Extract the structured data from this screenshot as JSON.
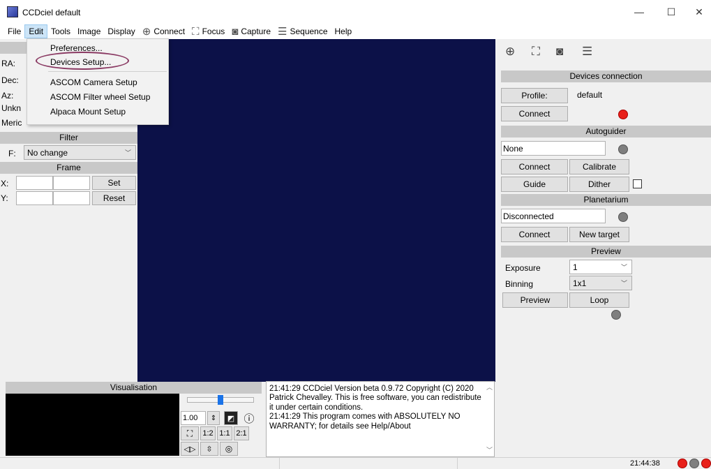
{
  "window": {
    "title": "CCDciel default",
    "minimize": "—",
    "maximize": "☐",
    "close": "✕"
  },
  "menubar": {
    "file": "File",
    "edit": "Edit",
    "tools": "Tools",
    "image": "Image",
    "display": "Display",
    "connect": "Connect",
    "focus": "Focus",
    "capture": "Capture",
    "sequence": "Sequence",
    "help": "Help"
  },
  "edit_menu": {
    "preferences": "Preferences...",
    "devices_setup": "Devices Setup...",
    "ascom_camera": "ASCOM Camera Setup",
    "ascom_filter": "ASCOM Filter wheel Setup",
    "alpaca_mount": "Alpaca Mount Setup"
  },
  "left_panel": {
    "ra_label": "RA:",
    "dec_label": "Dec:",
    "az_label": "Az:",
    "unknown_label": "Unkn",
    "meridian_label": "Meric",
    "filter_header": "Filter",
    "filter_label": "F:",
    "filter_value": "No change",
    "frame_header": "Frame",
    "x_label": "X:",
    "y_label": "Y:",
    "set_button": "Set",
    "reset_button": "Reset"
  },
  "visualisation": {
    "header": "Visualisation",
    "gamma_value": "1.00",
    "zoom_1_2": "1:2",
    "zoom_1_1": "1:1",
    "zoom_2_1": "2:1"
  },
  "log": {
    "lines": [
      "21:41:29 CCDciel Version beta 0.9.72 Copyright (C) 2020",
      "Patrick Chevalley. This is free software, you can redistribute",
      "it under certain conditions.",
      "21:41:29 This program comes with ABSOLUTELY NO",
      "WARRANTY; for details see Help/About"
    ]
  },
  "right_panel": {
    "devices_header": "Devices connection",
    "profile_button": "Profile:",
    "profile_value": "default",
    "connect_button": "Connect",
    "autoguider_header": "Autoguider",
    "autoguider_value": "None",
    "ag_connect": "Connect",
    "ag_calibrate": "Calibrate",
    "ag_guide": "Guide",
    "ag_dither": "Dither",
    "planetarium_header": "Planetarium",
    "planetarium_value": "Disconnected",
    "pl_connect": "Connect",
    "pl_new_target": "New target",
    "preview_header": "Preview",
    "exposure_label": "Exposure",
    "exposure_value": "1",
    "binning_label": "Binning",
    "binning_value": "1x1",
    "preview_button": "Preview",
    "loop_button": "Loop"
  },
  "statusbar": {
    "time": "21:44:38"
  },
  "colors": {
    "image_bg": "#0c1148",
    "led_red": "#e8201a",
    "led_gray": "#7f7f7f",
    "highlight": "#8a3a63"
  }
}
